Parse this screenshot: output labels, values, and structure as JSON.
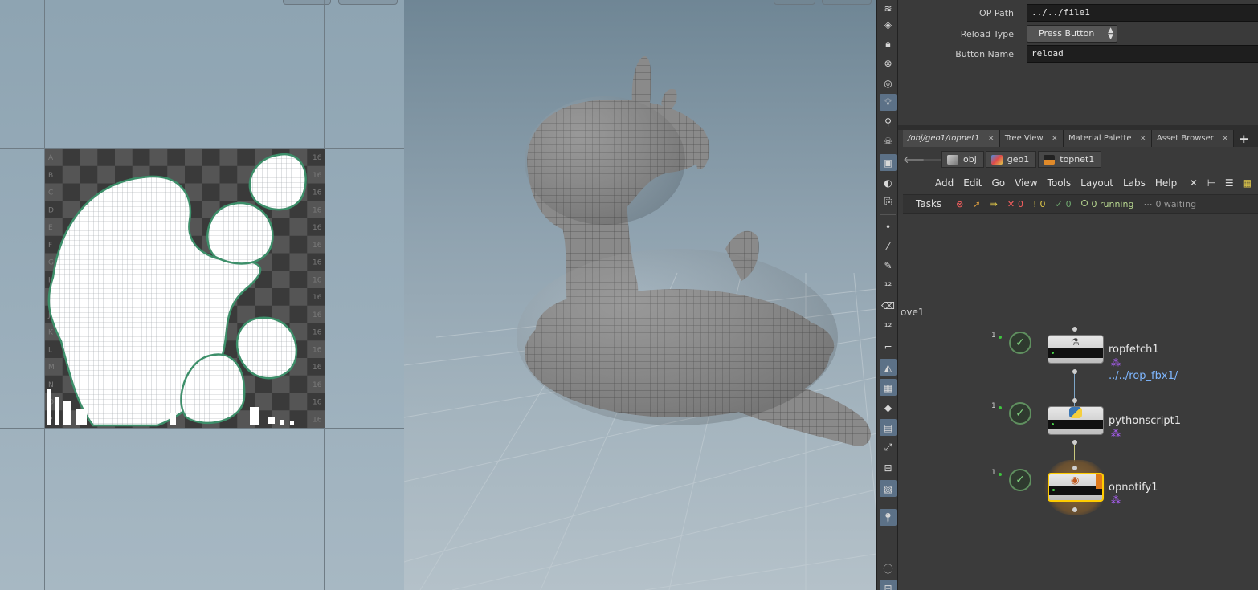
{
  "parameters": {
    "op_path_label": "OP Path",
    "op_path_value": "../../file1",
    "reload_type_label": "Reload Type",
    "reload_type_value": "Press Button",
    "button_name_label": "Button Name",
    "button_name_value": "reload"
  },
  "tabs": [
    {
      "label": "/obj/geo1/topnet1"
    },
    {
      "label": "Tree View"
    },
    {
      "label": "Material Palette"
    },
    {
      "label": "Asset Browser"
    }
  ],
  "tab_close_glyph": "×",
  "tab_add_glyph": "+",
  "breadcrumb": [
    {
      "label": "obj",
      "icon": "obj-icon"
    },
    {
      "label": "geo1",
      "icon": "geo-icon"
    },
    {
      "label": "topnet1",
      "icon": "topnet-icon"
    }
  ],
  "menu": [
    "Add",
    "Edit",
    "Go",
    "View",
    "Tools",
    "Layout",
    "Labs",
    "Help"
  ],
  "tasks": {
    "label": "Tasks",
    "errors": "0",
    "warnings": "0",
    "done": "0",
    "running": "0 running",
    "waiting": "0 waiting"
  },
  "network": {
    "edge_label": "ove1",
    "nodes": [
      {
        "name": "ropfetch1",
        "sub": "../../rop_fbx1/",
        "count": "1",
        "icon": "rop-fetch-icon"
      },
      {
        "name": "pythonscript1",
        "sub": "",
        "count": "1",
        "icon": "python-icon"
      },
      {
        "name": "opnotify1",
        "sub": "",
        "count": "1",
        "icon": "notify-icon"
      }
    ]
  },
  "uv_tile": {
    "row_letters": [
      "A",
      "B",
      "C",
      "D",
      "E",
      "F",
      "G",
      "H",
      "I",
      "J",
      "K",
      "L",
      "M",
      "N",
      "O",
      "P"
    ],
    "col_number": "16"
  },
  "colors": {
    "accent_selected": "#ffcc00",
    "uv_island_outline": "#3d8f6a",
    "toolbar_active": "#5c7187",
    "link_blue": "#7fb7ff",
    "badge_purple": "#b060ff"
  }
}
